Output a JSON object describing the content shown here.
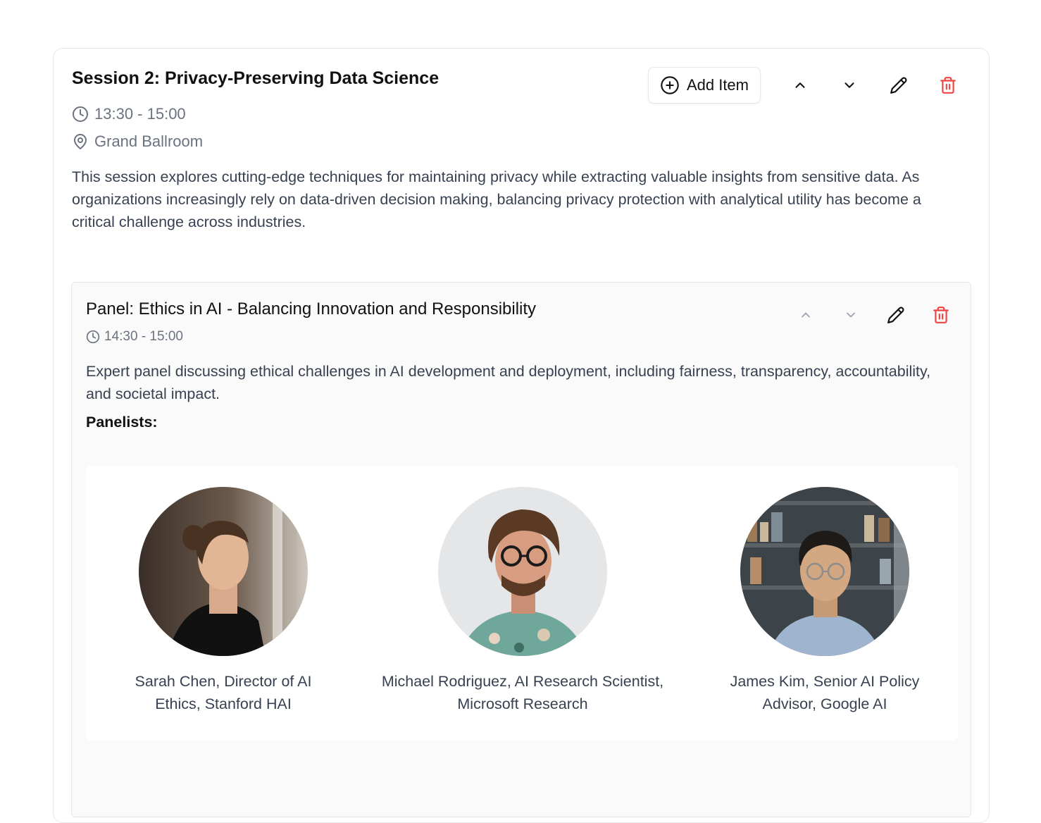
{
  "session": {
    "title": "Session 2: Privacy-Preserving Data Science",
    "time": "13:30 - 15:00",
    "location": "Grand Ballroom",
    "description": "This session explores cutting-edge techniques for maintaining privacy while extracting valuable insights from sensitive data. As organizations increasingly rely on data-driven decision making, balancing privacy protection with analytical utility has become a critical challenge across industries.",
    "add_item_label": "Add Item"
  },
  "panel": {
    "title": "Panel: Ethics in AI - Balancing Innovation and Responsibility",
    "time": "14:30 - 15:00",
    "description": "Expert panel discussing ethical challenges in AI development and deployment, including fairness, transparency, accountability, and societal impact.",
    "panelists_label": "Panelists:",
    "panelists": [
      {
        "name": "Sarah Chen, Director of AI Ethics, Stanford HAI",
        "avatar": "woman-portrait"
      },
      {
        "name": "Michael Rodriguez, AI Research Scientist, Microsoft Research",
        "avatar": "man-curly-hair-portrait"
      },
      {
        "name": "James Kim, Senior AI Policy Advisor, Google AI",
        "avatar": "man-glasses-portrait"
      }
    ]
  },
  "colors": {
    "delete": "#ef4444",
    "muted_text": "#6b7280",
    "body_text": "#374151",
    "border": "#e5e7eb"
  },
  "icons": [
    "clock-icon",
    "map-pin-icon",
    "plus-circle-icon",
    "chevron-up-icon",
    "chevron-down-icon",
    "pencil-icon",
    "trash-icon"
  ]
}
